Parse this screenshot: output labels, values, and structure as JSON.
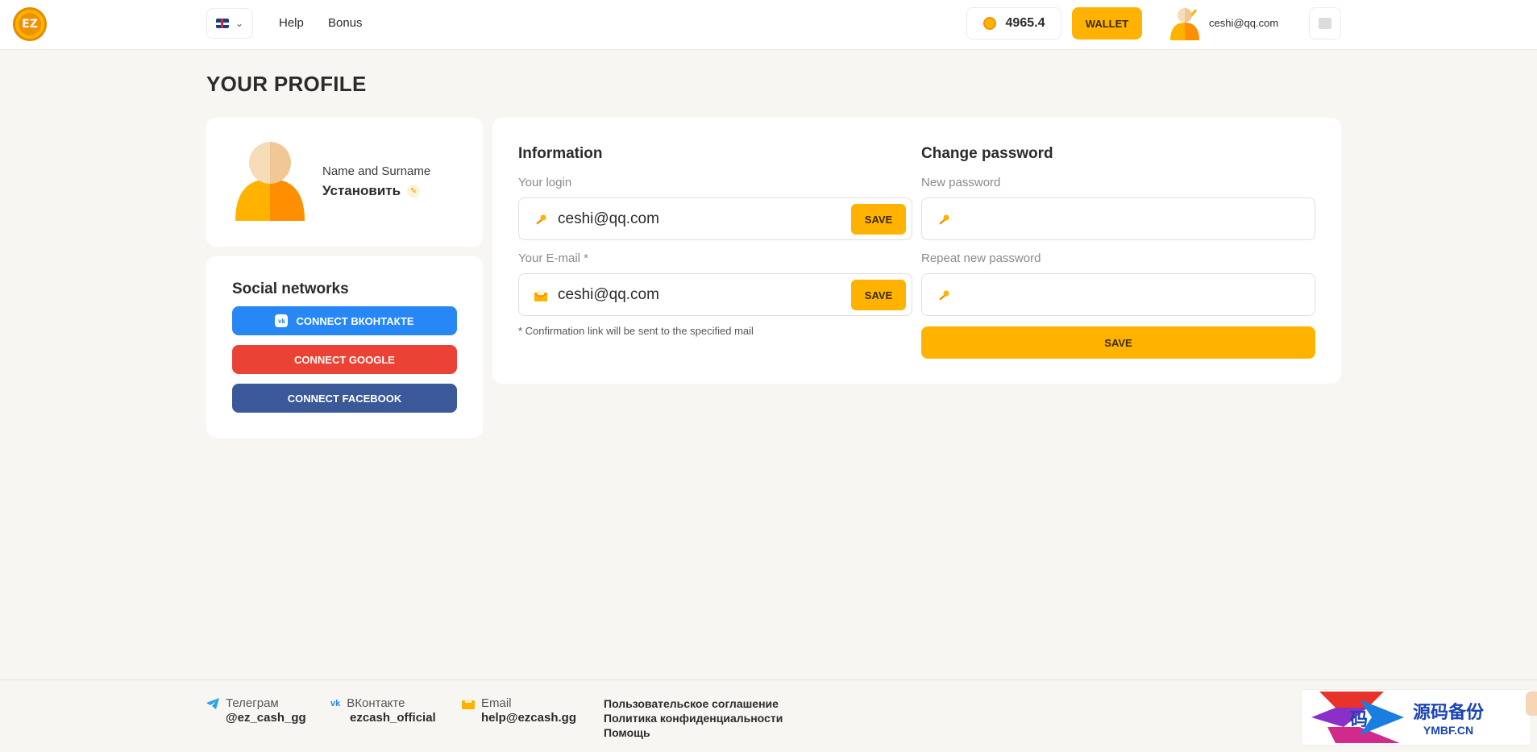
{
  "header": {
    "logo_text": "EZ",
    "nav": [
      {
        "label": "Help"
      },
      {
        "label": "Bonus"
      }
    ],
    "balance": "4965.4",
    "wallet_label": "WALLET",
    "user_email": "ceshi@qq.com"
  },
  "page": {
    "title": "YOUR PROFILE"
  },
  "profile": {
    "name_label": "Name and Surname",
    "name_value": "Установить"
  },
  "social": {
    "title": "Social networks",
    "buttons": [
      {
        "label": "CONNECT ВКОНТАКТЕ",
        "color": "#2787f5"
      },
      {
        "label": "CONNECT GOOGLE",
        "color": "#ea4335"
      },
      {
        "label": "CONNECT FACEBOOK",
        "color": "#3b5998"
      }
    ]
  },
  "information": {
    "title": "Information",
    "login_label": "Your login",
    "login_value": "ceshi@qq.com",
    "email_label": "Your E-mail *",
    "email_value": "ceshi@qq.com",
    "save_label": "SAVE",
    "hint": "* Confirmation link will be sent to the specified mail"
  },
  "password": {
    "title": "Change password",
    "new_label": "New password",
    "repeat_label": "Repeat new password",
    "save_label": "SAVE"
  },
  "footer": {
    "telegram_label": "Телеграм",
    "telegram_value": "@ez_cash_gg",
    "vk_label": "ВКонтакте",
    "vk_value": "ezcash_official",
    "email_label": "Email",
    "email_value": "help@ezcash.gg",
    "links": [
      {
        "label": "Пользовательское соглашение"
      },
      {
        "label": "Политика конфиденциальности"
      },
      {
        "label": "Помощь"
      }
    ]
  },
  "watermark": {
    "cn": "源码备份",
    "en": "YMBF.CN",
    "glyph": "码"
  },
  "colors": {
    "accent": "#ffb300",
    "accent_dark": "#f29100",
    "background": "#f8f6f3"
  }
}
